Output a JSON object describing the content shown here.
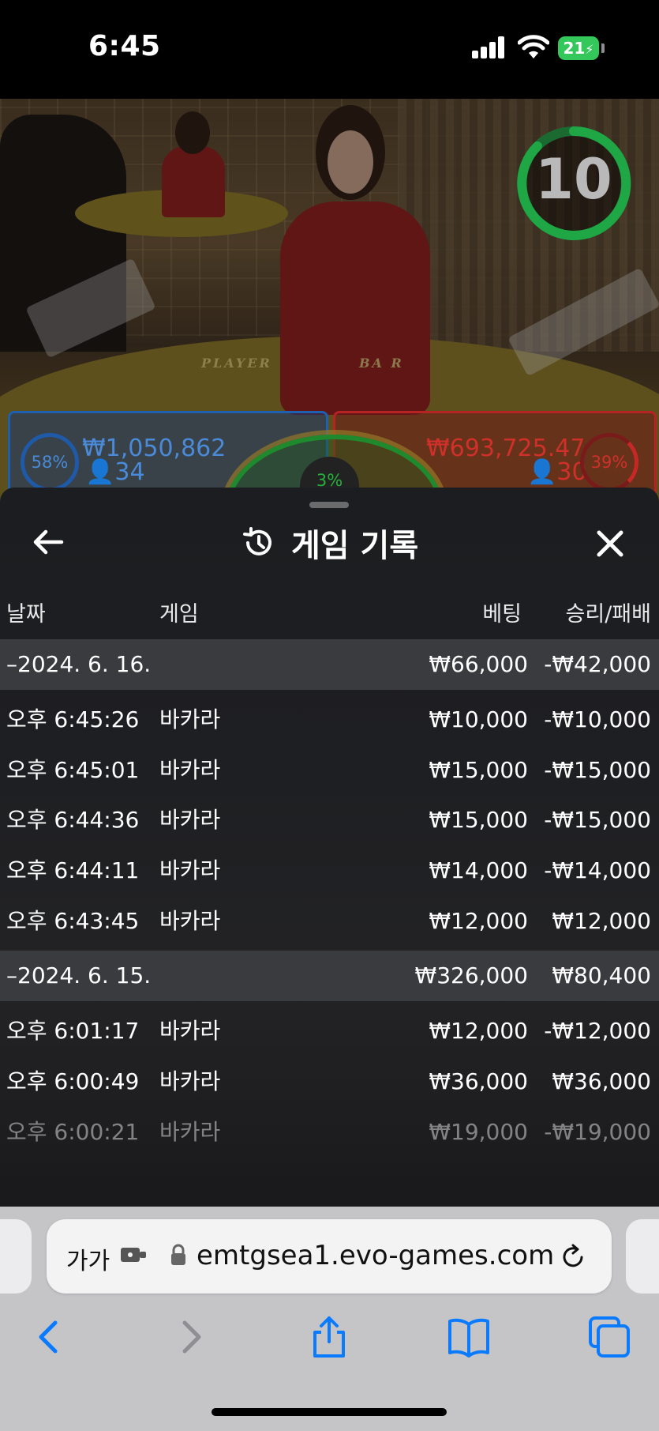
{
  "status_bar": {
    "time": "6:45",
    "battery": "21"
  },
  "video": {
    "timer": "10",
    "table_label_left": "PLAYER",
    "table_label_right": "BA     R",
    "player": {
      "percent": "58%",
      "amount": "₩1,050,862",
      "count": "34"
    },
    "banker": {
      "percent": "39%",
      "amount": "₩693,725.47",
      "count": "30"
    },
    "tie": {
      "percent": "3%"
    }
  },
  "sheet": {
    "title": "게임 기록",
    "columns": {
      "date": "날짜",
      "game": "게임",
      "bet": "베팅",
      "win_loss": "승리/패배"
    },
    "groups": [
      {
        "date": "–2024. 6. 16.",
        "bet": "₩66,000",
        "win_loss": "-₩42,000",
        "rows": [
          {
            "time": "오후 6:45:26",
            "game": "바카라",
            "bet": "₩10,000",
            "win_loss": "-₩10,000"
          },
          {
            "time": "오후 6:45:01",
            "game": "바카라",
            "bet": "₩15,000",
            "win_loss": "-₩15,000"
          },
          {
            "time": "오후 6:44:36",
            "game": "바카라",
            "bet": "₩15,000",
            "win_loss": "-₩15,000"
          },
          {
            "time": "오후 6:44:11",
            "game": "바카라",
            "bet": "₩14,000",
            "win_loss": "-₩14,000"
          },
          {
            "time": "오후 6:43:45",
            "game": "바카라",
            "bet": "₩12,000",
            "win_loss": "₩12,000"
          }
        ]
      },
      {
        "date": "–2024. 6. 15.",
        "bet": "₩326,000",
        "win_loss": "₩80,400",
        "rows": [
          {
            "time": "오후 6:01:17",
            "game": "바카라",
            "bet": "₩12,000",
            "win_loss": "-₩12,000"
          },
          {
            "time": "오후 6:00:49",
            "game": "바카라",
            "bet": "₩36,000",
            "win_loss": "₩36,000"
          },
          {
            "time": "오후 6:00:21",
            "game": "바카라",
            "bet": "₩19,000",
            "win_loss": "-₩19,000"
          }
        ]
      }
    ]
  },
  "browser": {
    "text_size": "가가",
    "url": "emtgsea1.evo-games.com"
  },
  "colors": {
    "accent_blue": "#0a7aff",
    "timer_green": "#1fa645",
    "player_blue": "#1e5fb0",
    "banker_red": "#b52323"
  }
}
